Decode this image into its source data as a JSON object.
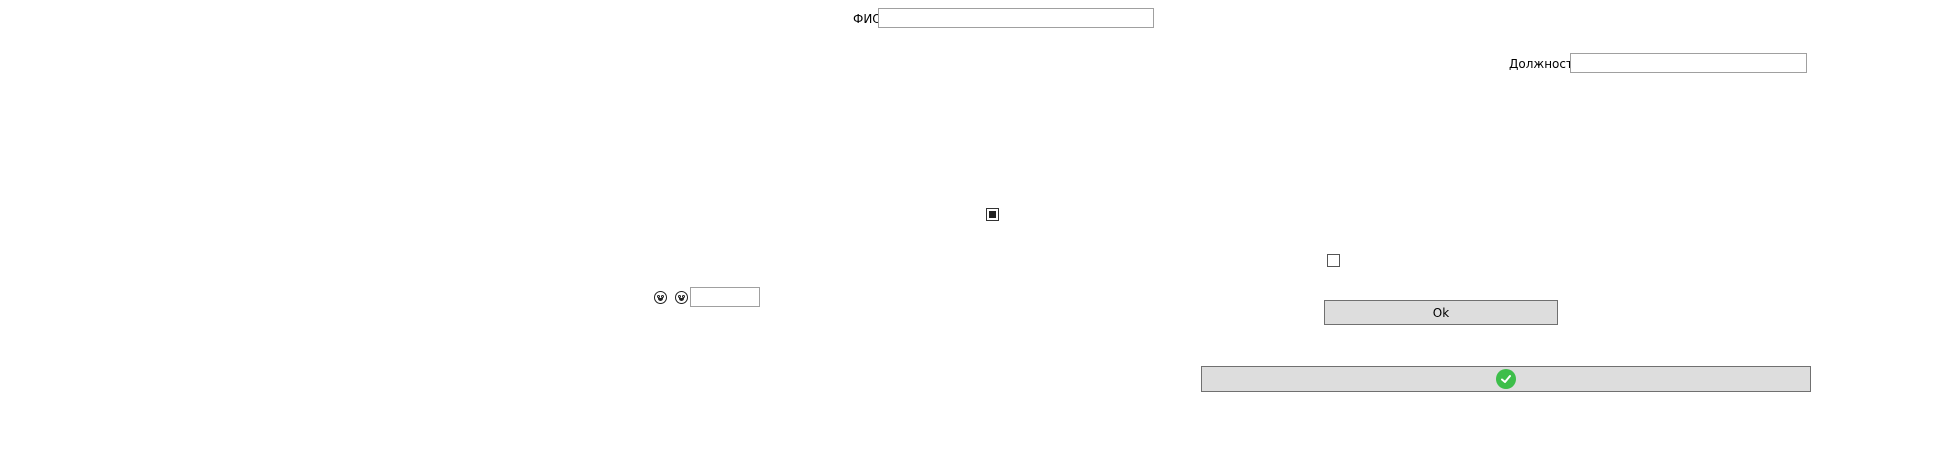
{
  "form": {
    "fio_label": "ФИО",
    "fio_value": "",
    "position_label": "Должность",
    "position_value": "",
    "small_input_value": "",
    "checkbox1_checked": true,
    "checkbox2_checked": false,
    "ok_button_label": "Ok"
  },
  "icons": {
    "emoji1": "grinning-face-icon",
    "emoji2": "smiling-face-icon",
    "confirm": "check-circle-icon"
  },
  "colors": {
    "button_bg": "#dddddd",
    "confirm_green": "#3dbe4a"
  }
}
